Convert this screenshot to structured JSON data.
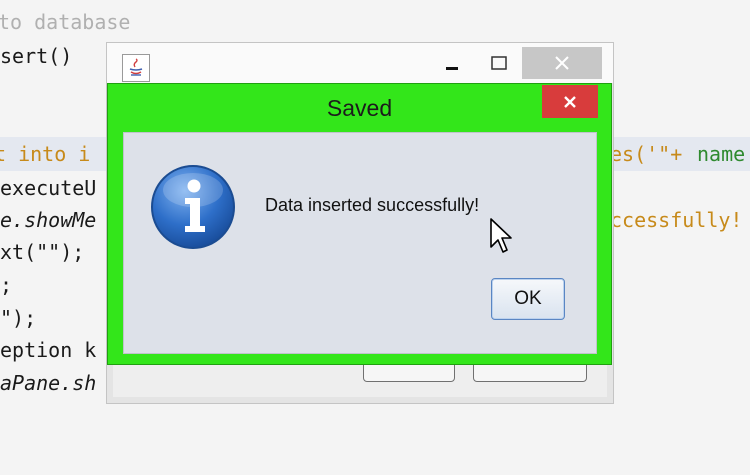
{
  "editor": {
    "lines": [
      {
        "text": "to database",
        "color": "#aaaaaa"
      },
      {
        "text": "sert()"
      },
      {
        "text": "t into i"
      },
      {
        "text": "es('\"+"
      },
      {
        "text": "name"
      },
      {
        "text": "executeU"
      },
      {
        "text": "e.showMe"
      },
      {
        "text": "ccessfully!"
      },
      {
        "text": "xt(\"\");"
      },
      {
        "text": ";"
      },
      {
        "text": "\");"
      },
      {
        "text": "eption k"
      },
      {
        "text": "aPane.sh"
      }
    ]
  },
  "frame": {
    "icon": "java-icon",
    "controls": {
      "minimize": "minimize-icon",
      "maximize": "maximize-icon",
      "close": "close-icon"
    }
  },
  "dialog": {
    "title": "Saved",
    "message": "Data inserted successfully!",
    "ok_label": "OK",
    "icon": "info-icon",
    "accent_color": "#33e61a",
    "close_color": "#d83c3c"
  }
}
